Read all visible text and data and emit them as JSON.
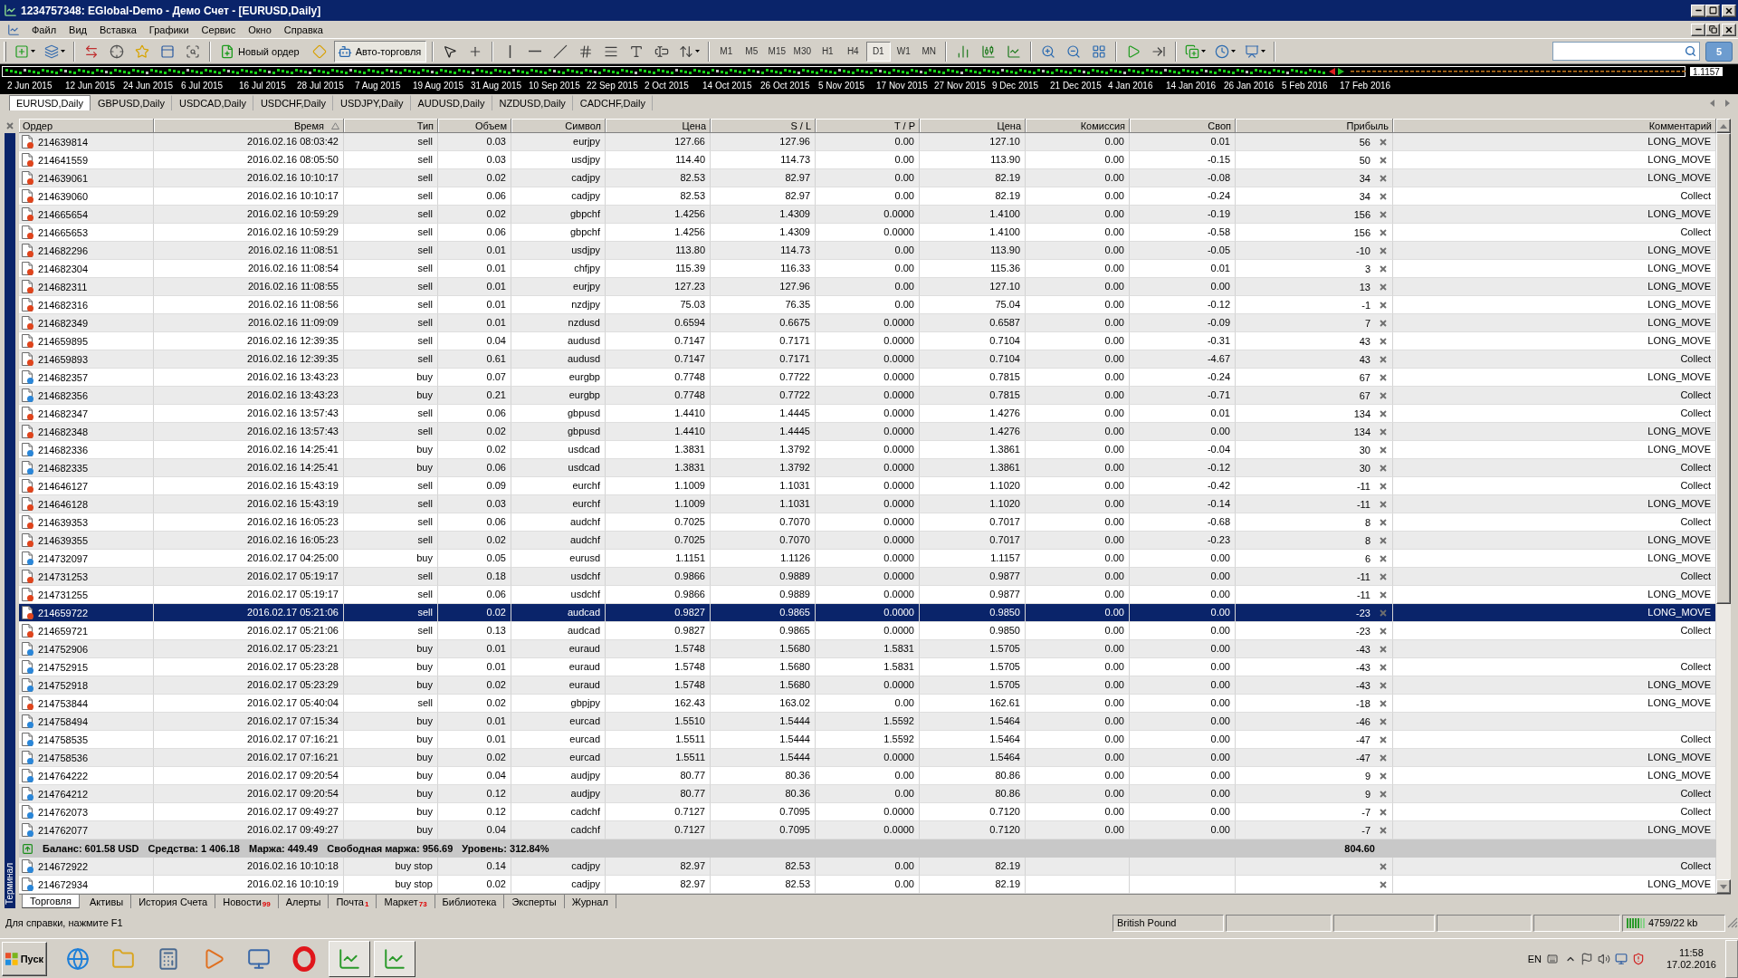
{
  "window": {
    "title": "1234757348: EGlobal-Demo - Демо Счет - [EURUSD,Daily]"
  },
  "menu": [
    "Файл",
    "Вид",
    "Вставка",
    "Графики",
    "Сервис",
    "Окно",
    "Справка"
  ],
  "toolbar": {
    "new_order": "Новый ордер",
    "autotrading": {
      "label": "Авто-торговля",
      "pressed": true
    },
    "timeframes": [
      {
        "label": "M1",
        "selected": false
      },
      {
        "label": "M5",
        "selected": false
      },
      {
        "label": "M15",
        "selected": false
      },
      {
        "label": "M30",
        "selected": false
      },
      {
        "label": "H1",
        "selected": false
      },
      {
        "label": "H4",
        "selected": false
      },
      {
        "label": "D1",
        "selected": true
      },
      {
        "label": "W1",
        "selected": false
      },
      {
        "label": "MN",
        "selected": false
      }
    ],
    "notifications": "5"
  },
  "chart": {
    "price_label": "1.1157",
    "dates": [
      "2 Jun 2015",
      "12 Jun 2015",
      "24 Jun 2015",
      "6 Jul 2015",
      "16 Jul 2015",
      "28 Jul 2015",
      "7 Aug 2015",
      "19 Aug 2015",
      "31 Aug 2015",
      "10 Sep 2015",
      "22 Sep 2015",
      "2 Oct 2015",
      "14 Oct 2015",
      "26 Oct 2015",
      "5 Nov 2015",
      "17 Nov 2015",
      "27 Nov 2015",
      "9 Dec 2015",
      "21 Dec 2015",
      "4 Jan 2016",
      "14 Jan 2016",
      "26 Jan 2016",
      "5 Feb 2016",
      "17 Feb 2016"
    ]
  },
  "chart_tabs": [
    {
      "label": "EURUSD,Daily",
      "selected": true
    },
    {
      "label": "GBPUSD,Daily",
      "selected": false
    },
    {
      "label": "USDCAD,Daily",
      "selected": false
    },
    {
      "label": "USDCHF,Daily",
      "selected": false
    },
    {
      "label": "USDJPY,Daily",
      "selected": false
    },
    {
      "label": "AUDUSD,Daily",
      "selected": false
    },
    {
      "label": "NZDUSD,Daily",
      "selected": false
    },
    {
      "label": "CADCHF,Daily",
      "selected": false
    }
  ],
  "terminal": {
    "title": "Терминал",
    "columns": [
      {
        "label": "Ордер",
        "sorted": false
      },
      {
        "label": "Время",
        "sorted": true
      },
      {
        "label": "Тип",
        "sorted": false
      },
      {
        "label": "Объем",
        "sorted": false
      },
      {
        "label": "Символ",
        "sorted": false
      },
      {
        "label": "Цена",
        "sorted": false
      },
      {
        "label": "S / L",
        "sorted": false
      },
      {
        "label": "T / P",
        "sorted": false
      },
      {
        "label": "Цена",
        "sorted": false
      },
      {
        "label": "Комиссия",
        "sorted": false
      },
      {
        "label": "Своп",
        "sorted": false
      },
      {
        "label": "Прибыль",
        "sorted": false
      },
      {
        "label": "Комментарий",
        "sorted": false
      }
    ],
    "rows": [
      {
        "order": "214639814",
        "time": "2016.02.16 08:03:42",
        "type": "sell",
        "volume": "0.03",
        "symbol": "eurjpy",
        "open_price": "127.66",
        "sl": "127.96",
        "tp": "0.00",
        "price": "127.10",
        "commission": "0.00",
        "swap": "0.01",
        "profit": "56",
        "comment": "LONG_MOVE",
        "color": "#e0441c",
        "selected": false
      },
      {
        "order": "214641559",
        "time": "2016.02.16 08:05:50",
        "type": "sell",
        "volume": "0.03",
        "symbol": "usdjpy",
        "open_price": "114.40",
        "sl": "114.73",
        "tp": "0.00",
        "price": "113.90",
        "commission": "0.00",
        "swap": "-0.15",
        "profit": "50",
        "comment": "LONG_MOVE",
        "color": "#e0441c",
        "selected": false
      },
      {
        "order": "214639061",
        "time": "2016.02.16 10:10:17",
        "type": "sell",
        "volume": "0.02",
        "symbol": "cadjpy",
        "open_price": "82.53",
        "sl": "82.97",
        "tp": "0.00",
        "price": "82.19",
        "commission": "0.00",
        "swap": "-0.08",
        "profit": "34",
        "comment": "LONG_MOVE",
        "color": "#e0441c",
        "selected": false
      },
      {
        "order": "214639060",
        "time": "2016.02.16 10:10:17",
        "type": "sell",
        "volume": "0.06",
        "symbol": "cadjpy",
        "open_price": "82.53",
        "sl": "82.97",
        "tp": "0.00",
        "price": "82.19",
        "commission": "0.00",
        "swap": "-0.24",
        "profit": "34",
        "comment": "Collect",
        "color": "#e0441c",
        "selected": false
      },
      {
        "order": "214665654",
        "time": "2016.02.16 10:59:29",
        "type": "sell",
        "volume": "0.02",
        "symbol": "gbpchf",
        "open_price": "1.4256",
        "sl": "1.4309",
        "tp": "0.0000",
        "price": "1.4100",
        "commission": "0.00",
        "swap": "-0.19",
        "profit": "156",
        "comment": "LONG_MOVE",
        "color": "#e0441c",
        "selected": false
      },
      {
        "order": "214665653",
        "time": "2016.02.16 10:59:29",
        "type": "sell",
        "volume": "0.06",
        "symbol": "gbpchf",
        "open_price": "1.4256",
        "sl": "1.4309",
        "tp": "0.0000",
        "price": "1.4100",
        "commission": "0.00",
        "swap": "-0.58",
        "profit": "156",
        "comment": "Collect",
        "color": "#e0441c",
        "selected": false
      },
      {
        "order": "214682296",
        "time": "2016.02.16 11:08:51",
        "type": "sell",
        "volume": "0.01",
        "symbol": "usdjpy",
        "open_price": "113.80",
        "sl": "114.73",
        "tp": "0.00",
        "price": "113.90",
        "commission": "0.00",
        "swap": "-0.05",
        "profit": "-10",
        "comment": "LONG_MOVE",
        "color": "#e0441c",
        "selected": false
      },
      {
        "order": "214682304",
        "time": "2016.02.16 11:08:54",
        "type": "sell",
        "volume": "0.01",
        "symbol": "chfjpy",
        "open_price": "115.39",
        "sl": "116.33",
        "tp": "0.00",
        "price": "115.36",
        "commission": "0.00",
        "swap": "0.01",
        "profit": "3",
        "comment": "LONG_MOVE",
        "color": "#e0441c",
        "selected": false
      },
      {
        "order": "214682311",
        "time": "2016.02.16 11:08:55",
        "type": "sell",
        "volume": "0.01",
        "symbol": "eurjpy",
        "open_price": "127.23",
        "sl": "127.96",
        "tp": "0.00",
        "price": "127.10",
        "commission": "0.00",
        "swap": "0.00",
        "profit": "13",
        "comment": "LONG_MOVE",
        "color": "#e0441c",
        "selected": false
      },
      {
        "order": "214682316",
        "time": "2016.02.16 11:08:56",
        "type": "sell",
        "volume": "0.01",
        "symbol": "nzdjpy",
        "open_price": "75.03",
        "sl": "76.35",
        "tp": "0.00",
        "price": "75.04",
        "commission": "0.00",
        "swap": "-0.12",
        "profit": "-1",
        "comment": "LONG_MOVE",
        "color": "#e0441c",
        "selected": false
      },
      {
        "order": "214682349",
        "time": "2016.02.16 11:09:09",
        "type": "sell",
        "volume": "0.01",
        "symbol": "nzdusd",
        "open_price": "0.6594",
        "sl": "0.6675",
        "tp": "0.0000",
        "price": "0.6587",
        "commission": "0.00",
        "swap": "-0.09",
        "profit": "7",
        "comment": "LONG_MOVE",
        "color": "#e0441c",
        "selected": false
      },
      {
        "order": "214659895",
        "time": "2016.02.16 12:39:35",
        "type": "sell",
        "volume": "0.04",
        "symbol": "audusd",
        "open_price": "0.7147",
        "sl": "0.7171",
        "tp": "0.0000",
        "price": "0.7104",
        "commission": "0.00",
        "swap": "-0.31",
        "profit": "43",
        "comment": "LONG_MOVE",
        "color": "#e0441c",
        "selected": false
      },
      {
        "order": "214659893",
        "time": "2016.02.16 12:39:35",
        "type": "sell",
        "volume": "0.61",
        "symbol": "audusd",
        "open_price": "0.7147",
        "sl": "0.7171",
        "tp": "0.0000",
        "price": "0.7104",
        "commission": "0.00",
        "swap": "-4.67",
        "profit": "43",
        "comment": "Collect",
        "color": "#e0441c",
        "selected": false
      },
      {
        "order": "214682357",
        "time": "2016.02.16 13:43:23",
        "type": "buy",
        "volume": "0.07",
        "symbol": "eurgbp",
        "open_price": "0.7748",
        "sl": "0.7722",
        "tp": "0.0000",
        "price": "0.7815",
        "commission": "0.00",
        "swap": "-0.24",
        "profit": "67",
        "comment": "LONG_MOVE",
        "color": "#2a86d8",
        "selected": false
      },
      {
        "order": "214682356",
        "time": "2016.02.16 13:43:23",
        "type": "buy",
        "volume": "0.21",
        "symbol": "eurgbp",
        "open_price": "0.7748",
        "sl": "0.7722",
        "tp": "0.0000",
        "price": "0.7815",
        "commission": "0.00",
        "swap": "-0.71",
        "profit": "67",
        "comment": "Collect",
        "color": "#2a86d8",
        "selected": false
      },
      {
        "order": "214682347",
        "time": "2016.02.16 13:57:43",
        "type": "sell",
        "volume": "0.06",
        "symbol": "gbpusd",
        "open_price": "1.4410",
        "sl": "1.4445",
        "tp": "0.0000",
        "price": "1.4276",
        "commission": "0.00",
        "swap": "0.01",
        "profit": "134",
        "comment": "Collect",
        "color": "#e0441c",
        "selected": false
      },
      {
        "order": "214682348",
        "time": "2016.02.16 13:57:43",
        "type": "sell",
        "volume": "0.02",
        "symbol": "gbpusd",
        "open_price": "1.4410",
        "sl": "1.4445",
        "tp": "0.0000",
        "price": "1.4276",
        "commission": "0.00",
        "swap": "0.00",
        "profit": "134",
        "comment": "LONG_MOVE",
        "color": "#e0441c",
        "selected": false
      },
      {
        "order": "214682336",
        "time": "2016.02.16 14:25:41",
        "type": "buy",
        "volume": "0.02",
        "symbol": "usdcad",
        "open_price": "1.3831",
        "sl": "1.3792",
        "tp": "0.0000",
        "price": "1.3861",
        "commission": "0.00",
        "swap": "-0.04",
        "profit": "30",
        "comment": "LONG_MOVE",
        "color": "#2a86d8",
        "selected": false
      },
      {
        "order": "214682335",
        "time": "2016.02.16 14:25:41",
        "type": "buy",
        "volume": "0.06",
        "symbol": "usdcad",
        "open_price": "1.3831",
        "sl": "1.3792",
        "tp": "0.0000",
        "price": "1.3861",
        "commission": "0.00",
        "swap": "-0.12",
        "profit": "30",
        "comment": "Collect",
        "color": "#2a86d8",
        "selected": false
      },
      {
        "order": "214646127",
        "time": "2016.02.16 15:43:19",
        "type": "sell",
        "volume": "0.09",
        "symbol": "eurchf",
        "open_price": "1.1009",
        "sl": "1.1031",
        "tp": "0.0000",
        "price": "1.1020",
        "commission": "0.00",
        "swap": "-0.42",
        "profit": "-11",
        "comment": "Collect",
        "color": "#e0441c",
        "selected": false
      },
      {
        "order": "214646128",
        "time": "2016.02.16 15:43:19",
        "type": "sell",
        "volume": "0.03",
        "symbol": "eurchf",
        "open_price": "1.1009",
        "sl": "1.1031",
        "tp": "0.0000",
        "price": "1.1020",
        "commission": "0.00",
        "swap": "-0.14",
        "profit": "-11",
        "comment": "LONG_MOVE",
        "color": "#e0441c",
        "selected": false
      },
      {
        "order": "214639353",
        "time": "2016.02.16 16:05:23",
        "type": "sell",
        "volume": "0.06",
        "symbol": "audchf",
        "open_price": "0.7025",
        "sl": "0.7070",
        "tp": "0.0000",
        "price": "0.7017",
        "commission": "0.00",
        "swap": "-0.68",
        "profit": "8",
        "comment": "Collect",
        "color": "#e0441c",
        "selected": false
      },
      {
        "order": "214639355",
        "time": "2016.02.16 16:05:23",
        "type": "sell",
        "volume": "0.02",
        "symbol": "audchf",
        "open_price": "0.7025",
        "sl": "0.7070",
        "tp": "0.0000",
        "price": "0.7017",
        "commission": "0.00",
        "swap": "-0.23",
        "profit": "8",
        "comment": "LONG_MOVE",
        "color": "#e0441c",
        "selected": false
      },
      {
        "order": "214732097",
        "time": "2016.02.17 04:25:00",
        "type": "buy",
        "volume": "0.05",
        "symbol": "eurusd",
        "open_price": "1.1151",
        "sl": "1.1126",
        "tp": "0.0000",
        "price": "1.1157",
        "commission": "0.00",
        "swap": "0.00",
        "profit": "6",
        "comment": "LONG_MOVE",
        "color": "#2a86d8",
        "selected": false
      },
      {
        "order": "214731253",
        "time": "2016.02.17 05:19:17",
        "type": "sell",
        "volume": "0.18",
        "symbol": "usdchf",
        "open_price": "0.9866",
        "sl": "0.9889",
        "tp": "0.0000",
        "price": "0.9877",
        "commission": "0.00",
        "swap": "0.00",
        "profit": "-11",
        "comment": "Collect",
        "color": "#e0441c",
        "selected": false
      },
      {
        "order": "214731255",
        "time": "2016.02.17 05:19:17",
        "type": "sell",
        "volume": "0.06",
        "symbol": "usdchf",
        "open_price": "0.9866",
        "sl": "0.9889",
        "tp": "0.0000",
        "price": "0.9877",
        "commission": "0.00",
        "swap": "0.00",
        "profit": "-11",
        "comment": "LONG_MOVE",
        "color": "#e0441c",
        "selected": false
      },
      {
        "order": "214659722",
        "time": "2016.02.17 05:21:06",
        "type": "sell",
        "volume": "0.02",
        "symbol": "audcad",
        "open_price": "0.9827",
        "sl": "0.9865",
        "tp": "0.0000",
        "price": "0.9850",
        "commission": "0.00",
        "swap": "0.00",
        "profit": "-23",
        "comment": "LONG_MOVE",
        "color": "#e0441c",
        "selected": true
      },
      {
        "order": "214659721",
        "time": "2016.02.17 05:21:06",
        "type": "sell",
        "volume": "0.13",
        "symbol": "audcad",
        "open_price": "0.9827",
        "sl": "0.9865",
        "tp": "0.0000",
        "price": "0.9850",
        "commission": "0.00",
        "swap": "0.00",
        "profit": "-23",
        "comment": "Collect",
        "color": "#e0441c",
        "selected": false
      },
      {
        "order": "214752906",
        "time": "2016.02.17 05:23:21",
        "type": "buy",
        "volume": "0.01",
        "symbol": "euraud",
        "open_price": "1.5748",
        "sl": "1.5680",
        "tp": "1.5831",
        "price": "1.5705",
        "commission": "0.00",
        "swap": "0.00",
        "profit": "-43",
        "color": "#2a86d8",
        "selected": false
      },
      {
        "order": "214752915",
        "time": "2016.02.17 05:23:28",
        "type": "buy",
        "volume": "0.01",
        "symbol": "euraud",
        "open_price": "1.5748",
        "sl": "1.5680",
        "tp": "1.5831",
        "price": "1.5705",
        "commission": "0.00",
        "swap": "0.00",
        "profit": "-43",
        "comment": "Collect",
        "color": "#2a86d8",
        "selected": false
      },
      {
        "order": "214752918",
        "time": "2016.02.17 05:23:29",
        "type": "buy",
        "volume": "0.02",
        "symbol": "euraud",
        "open_price": "1.5748",
        "sl": "1.5680",
        "tp": "0.0000",
        "price": "1.5705",
        "commission": "0.00",
        "swap": "0.00",
        "profit": "-43",
        "comment": "LONG_MOVE",
        "color": "#2a86d8",
        "selected": false
      },
      {
        "order": "214753844",
        "time": "2016.02.17 05:40:04",
        "type": "sell",
        "volume": "0.02",
        "symbol": "gbpjpy",
        "open_price": "162.43",
        "sl": "163.02",
        "tp": "0.00",
        "price": "162.61",
        "commission": "0.00",
        "swap": "0.00",
        "profit": "-18",
        "comment": "LONG_MOVE",
        "color": "#e0441c",
        "selected": false
      },
      {
        "order": "214758494",
        "time": "2016.02.17 07:15:34",
        "type": "buy",
        "volume": "0.01",
        "symbol": "eurcad",
        "open_price": "1.5510",
        "sl": "1.5444",
        "tp": "1.5592",
        "price": "1.5464",
        "commission": "0.00",
        "swap": "0.00",
        "profit": "-46",
        "color": "#2a86d8",
        "selected": false
      },
      {
        "order": "214758535",
        "time": "2016.02.17 07:16:21",
        "type": "buy",
        "volume": "0.01",
        "symbol": "eurcad",
        "open_price": "1.5511",
        "sl": "1.5444",
        "tp": "1.5592",
        "price": "1.5464",
        "commission": "0.00",
        "swap": "0.00",
        "profit": "-47",
        "comment": "Collect",
        "color": "#2a86d8",
        "selected": false
      },
      {
        "order": "214758536",
        "time": "2016.02.17 07:16:21",
        "type": "buy",
        "volume": "0.02",
        "symbol": "eurcad",
        "open_price": "1.5511",
        "sl": "1.5444",
        "tp": "0.0000",
        "price": "1.5464",
        "commission": "0.00",
        "swap": "0.00",
        "profit": "-47",
        "comment": "LONG_MOVE",
        "color": "#2a86d8",
        "selected": false
      },
      {
        "order": "214764222",
        "time": "2016.02.17 09:20:54",
        "type": "buy",
        "volume": "0.04",
        "symbol": "audjpy",
        "open_price": "80.77",
        "sl": "80.36",
        "tp": "0.00",
        "price": "80.86",
        "commission": "0.00",
        "swap": "0.00",
        "profit": "9",
        "comment": "LONG_MOVE",
        "color": "#2a86d8",
        "selected": false
      },
      {
        "order": "214764212",
        "time": "2016.02.17 09:20:54",
        "type": "buy",
        "volume": "0.12",
        "symbol": "audjpy",
        "open_price": "80.77",
        "sl": "80.36",
        "tp": "0.00",
        "price": "80.86",
        "commission": "0.00",
        "swap": "0.00",
        "profit": "9",
        "comment": "Collect",
        "color": "#2a86d8",
        "selected": false
      },
      {
        "order": "214762073",
        "time": "2016.02.17 09:49:27",
        "type": "buy",
        "volume": "0.12",
        "symbol": "cadchf",
        "open_price": "0.7127",
        "sl": "0.7095",
        "tp": "0.0000",
        "price": "0.7120",
        "commission": "0.00",
        "swap": "0.00",
        "profit": "-7",
        "comment": "Collect",
        "color": "#2a86d8",
        "selected": false
      },
      {
        "order": "214762077",
        "time": "2016.02.17 09:49:27",
        "type": "buy",
        "volume": "0.04",
        "symbol": "cadchf",
        "open_price": "0.7127",
        "sl": "0.7095",
        "tp": "0.0000",
        "price": "0.7120",
        "commission": "0.00",
        "swap": "0.00",
        "profit": "-7",
        "comment": "LONG_MOVE",
        "color": "#2a86d8",
        "selected": false
      }
    ],
    "summary": {
      "items": [
        "Баланс: 601.58 USD",
        "Средства: 1 406.18",
        "Маржа: 449.49",
        "Свободная маржа: 956.69",
        "Уровень: 312.84%"
      ],
      "profit": "804.60"
    },
    "pending_rows": [
      {
        "order": "214672922",
        "time": "2016.02.16 10:10:18",
        "type": "buy stop",
        "volume": "0.14",
        "symbol": "cadjpy",
        "open_price": "82.97",
        "sl": "82.53",
        "tp": "0.00",
        "price": "82.19",
        "comment": "Collect",
        "color": "#2a86d8",
        "selected": false
      },
      {
        "order": "214672934",
        "time": "2016.02.16 10:10:19",
        "type": "buy stop",
        "volume": "0.02",
        "symbol": "cadjpy",
        "open_price": "82.97",
        "sl": "82.53",
        "tp": "0.00",
        "price": "82.19",
        "comment": "LONG_MOVE",
        "color": "#2a86d8",
        "selected": false
      }
    ],
    "tabs": [
      {
        "label": "Торговля",
        "selected": true
      },
      {
        "label": "Активы",
        "selected": false
      },
      {
        "label": "История Счета",
        "selected": false
      },
      {
        "label": "Новости",
        "count": "99",
        "selected": false
      },
      {
        "label": "Алерты",
        "selected": false
      },
      {
        "label": "Почта",
        "count": "1",
        "selected": false
      },
      {
        "label": "Маркет",
        "count": "73",
        "selected": false
      },
      {
        "label": "Библиотека",
        "selected": false
      },
      {
        "label": "Эксперты",
        "selected": false
      },
      {
        "label": "Журнал",
        "selected": false
      }
    ]
  },
  "status_bar": {
    "help": "Для справки, нажмите F1",
    "symbol": "British Pound",
    "traffic": "4759/22 kb"
  },
  "taskbar": {
    "start": "Пуск",
    "apps": [
      {
        "running": false
      },
      {
        "running": false
      },
      {
        "running": false
      },
      {
        "running": false
      },
      {
        "running": false
      },
      {
        "running": false
      },
      {
        "running": true
      },
      {
        "running": true
      }
    ],
    "language": "EN",
    "time": "11:58",
    "date": "17.02.2016"
  }
}
